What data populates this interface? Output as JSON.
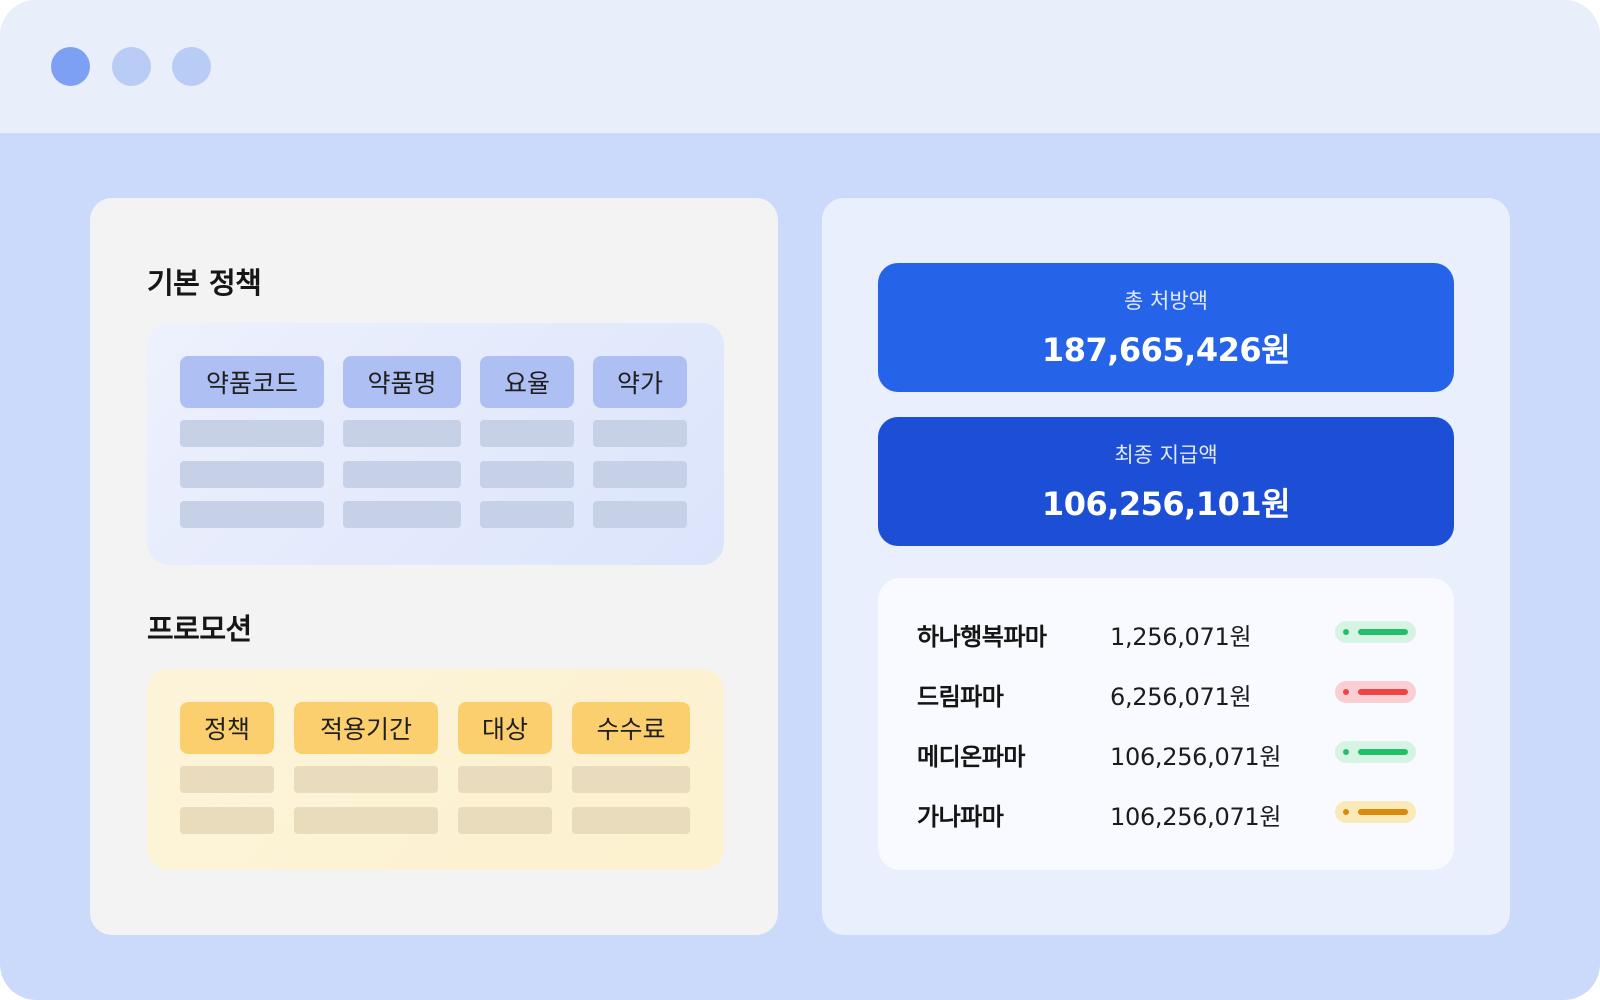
{
  "left_panel": {
    "basic_policy": {
      "title": "기본 정책",
      "headers": [
        "약품코드",
        "약품명",
        "요율",
        "약가"
      ]
    },
    "promotion": {
      "title": "프로모션",
      "headers": [
        "정책",
        "적용기간",
        "대상",
        "수수료"
      ]
    }
  },
  "right_panel": {
    "total_prescription": {
      "label": "총 처방액",
      "amount": "187,665,426원"
    },
    "final_payment": {
      "label": "최종 지급액",
      "amount": "106,256,101원"
    },
    "pharmas": [
      {
        "name": "하나행복파마",
        "amount": "1,256,071원",
        "status": "green"
      },
      {
        "name": "드림파마",
        "amount": "6,256,071원",
        "status": "red"
      },
      {
        "name": "메디온파마",
        "amount": "106,256,071원",
        "status": "green"
      },
      {
        "name": "가나파마",
        "amount": "106,256,071원",
        "status": "orange"
      }
    ]
  },
  "colors": {
    "accent_blue": "#2563e8",
    "accent_blue_dark": "#1c4fd6",
    "status_green": "#22c06a",
    "status_red": "#ef4444",
    "status_orange": "#d98a0b"
  }
}
